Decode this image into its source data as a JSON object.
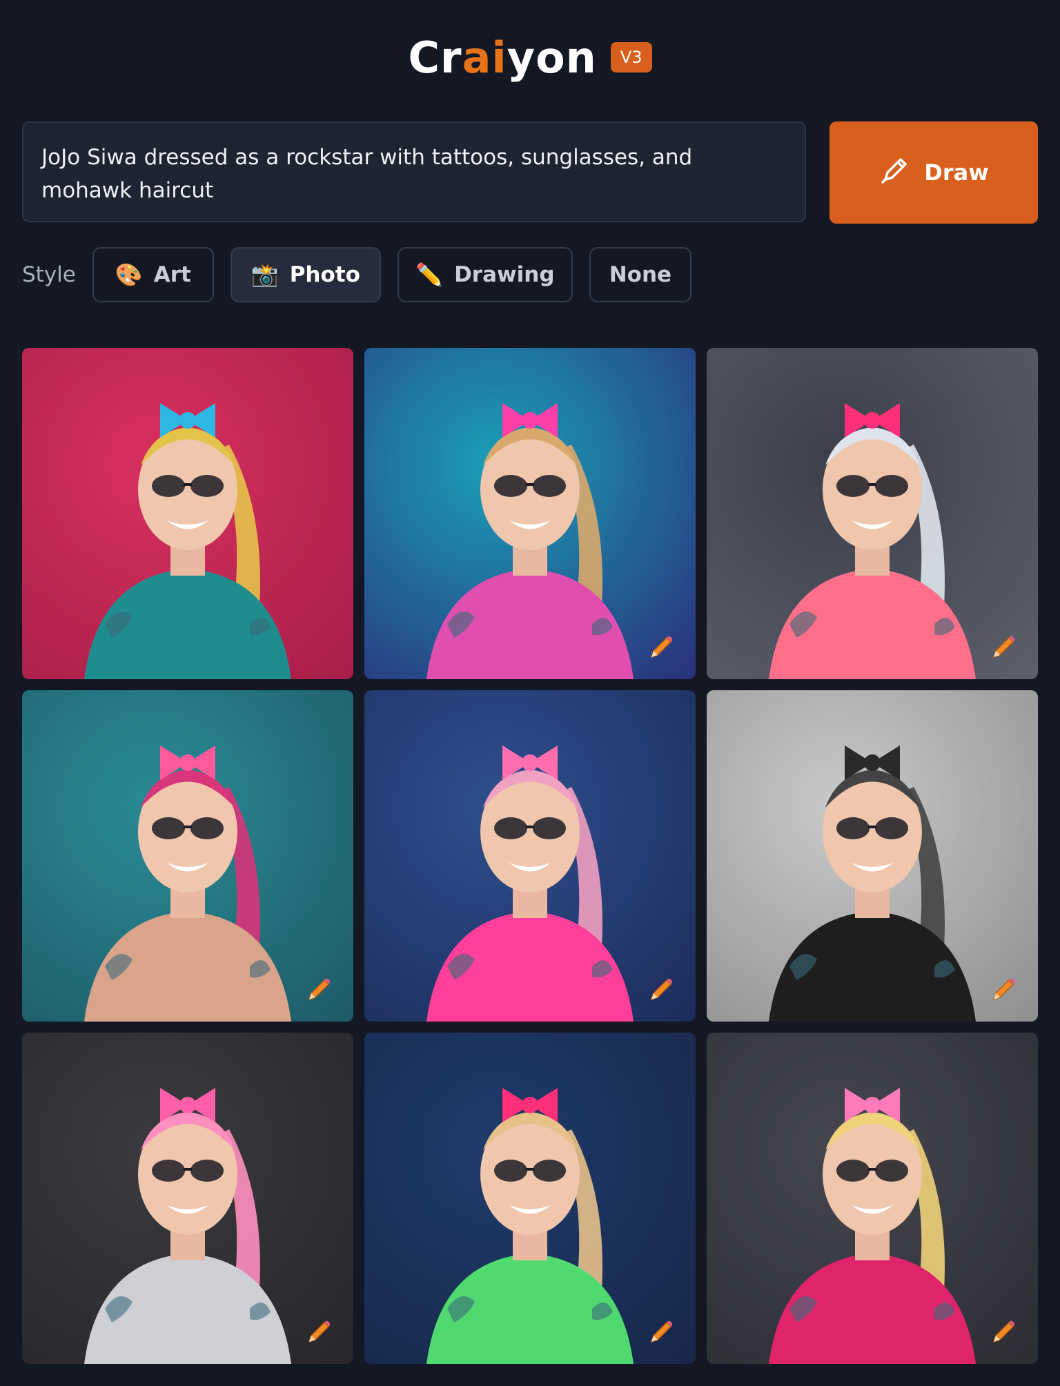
{
  "header": {
    "logo_pre": "Cr",
    "logo_a": "a",
    "logo_i": "i",
    "logo_post": "yon",
    "version_badge": "V3"
  },
  "prompt": {
    "text": "JoJo Siwa dressed as a rockstar with tattoos, sunglasses, and mohawk haircut"
  },
  "draw_button": {
    "label": "Draw",
    "icon": "pencil-icon"
  },
  "style": {
    "label": "Style",
    "options": [
      {
        "emoji": "🎨",
        "label": "Art",
        "active": false
      },
      {
        "emoji": "📸",
        "label": "Photo",
        "active": true
      },
      {
        "emoji": "✏️",
        "label": "Drawing",
        "active": false
      },
      {
        "emoji": "",
        "label": "None",
        "active": false
      }
    ]
  },
  "colors": {
    "accent": "#d9601c",
    "background": "#141824",
    "panel": "#1f2433"
  },
  "images": [
    {
      "bg1": "#d8305e",
      "bg2": "#a61e48",
      "hair": "#e4c34a",
      "bow": "#2fb7e4",
      "shirt": "#1f8c8e"
    },
    {
      "bg1": "#1aa0b8",
      "bg2": "#2a2f7a",
      "hair": "#d9a86c",
      "bow": "#ff3fa8",
      "shirt": "#e04fb0"
    },
    {
      "bg1": "#3c3f4a",
      "bg2": "#5c606c",
      "hair": "#dfe4ec",
      "bow": "#ff2f7a",
      "shirt": "#ff6f8a"
    },
    {
      "bg1": "#2a8b96",
      "bg2": "#1d5a66",
      "hair": "#d8357a",
      "bow": "#ff5a9a",
      "shirt": "#d9a48a"
    },
    {
      "bg1": "#2e4f8e",
      "bg2": "#1c2c5a",
      "hair": "#f0a0c0",
      "bow": "#ff6fb0",
      "shirt": "#ff3f9a"
    },
    {
      "bg1": "#c9c9c9",
      "bg2": "#8f8f8f",
      "hair": "#444444",
      "bow": "#2a2a2a",
      "shirt": "#1e1e1e"
    },
    {
      "bg1": "#3a3a3f",
      "bg2": "#27272b",
      "hair": "#ff8fbf",
      "bow": "#ff5fa8",
      "shirt": "#cfcfd6"
    },
    {
      "bg1": "#1e3c6a",
      "bg2": "#18264a",
      "hair": "#e8c08a",
      "bow": "#ff2f7a",
      "shirt": "#4fd96f"
    },
    {
      "bg1": "#45464f",
      "bg2": "#2c2d33",
      "hair": "#f0d27a",
      "bow": "#ff7ab8",
      "shirt": "#e0246a"
    }
  ]
}
